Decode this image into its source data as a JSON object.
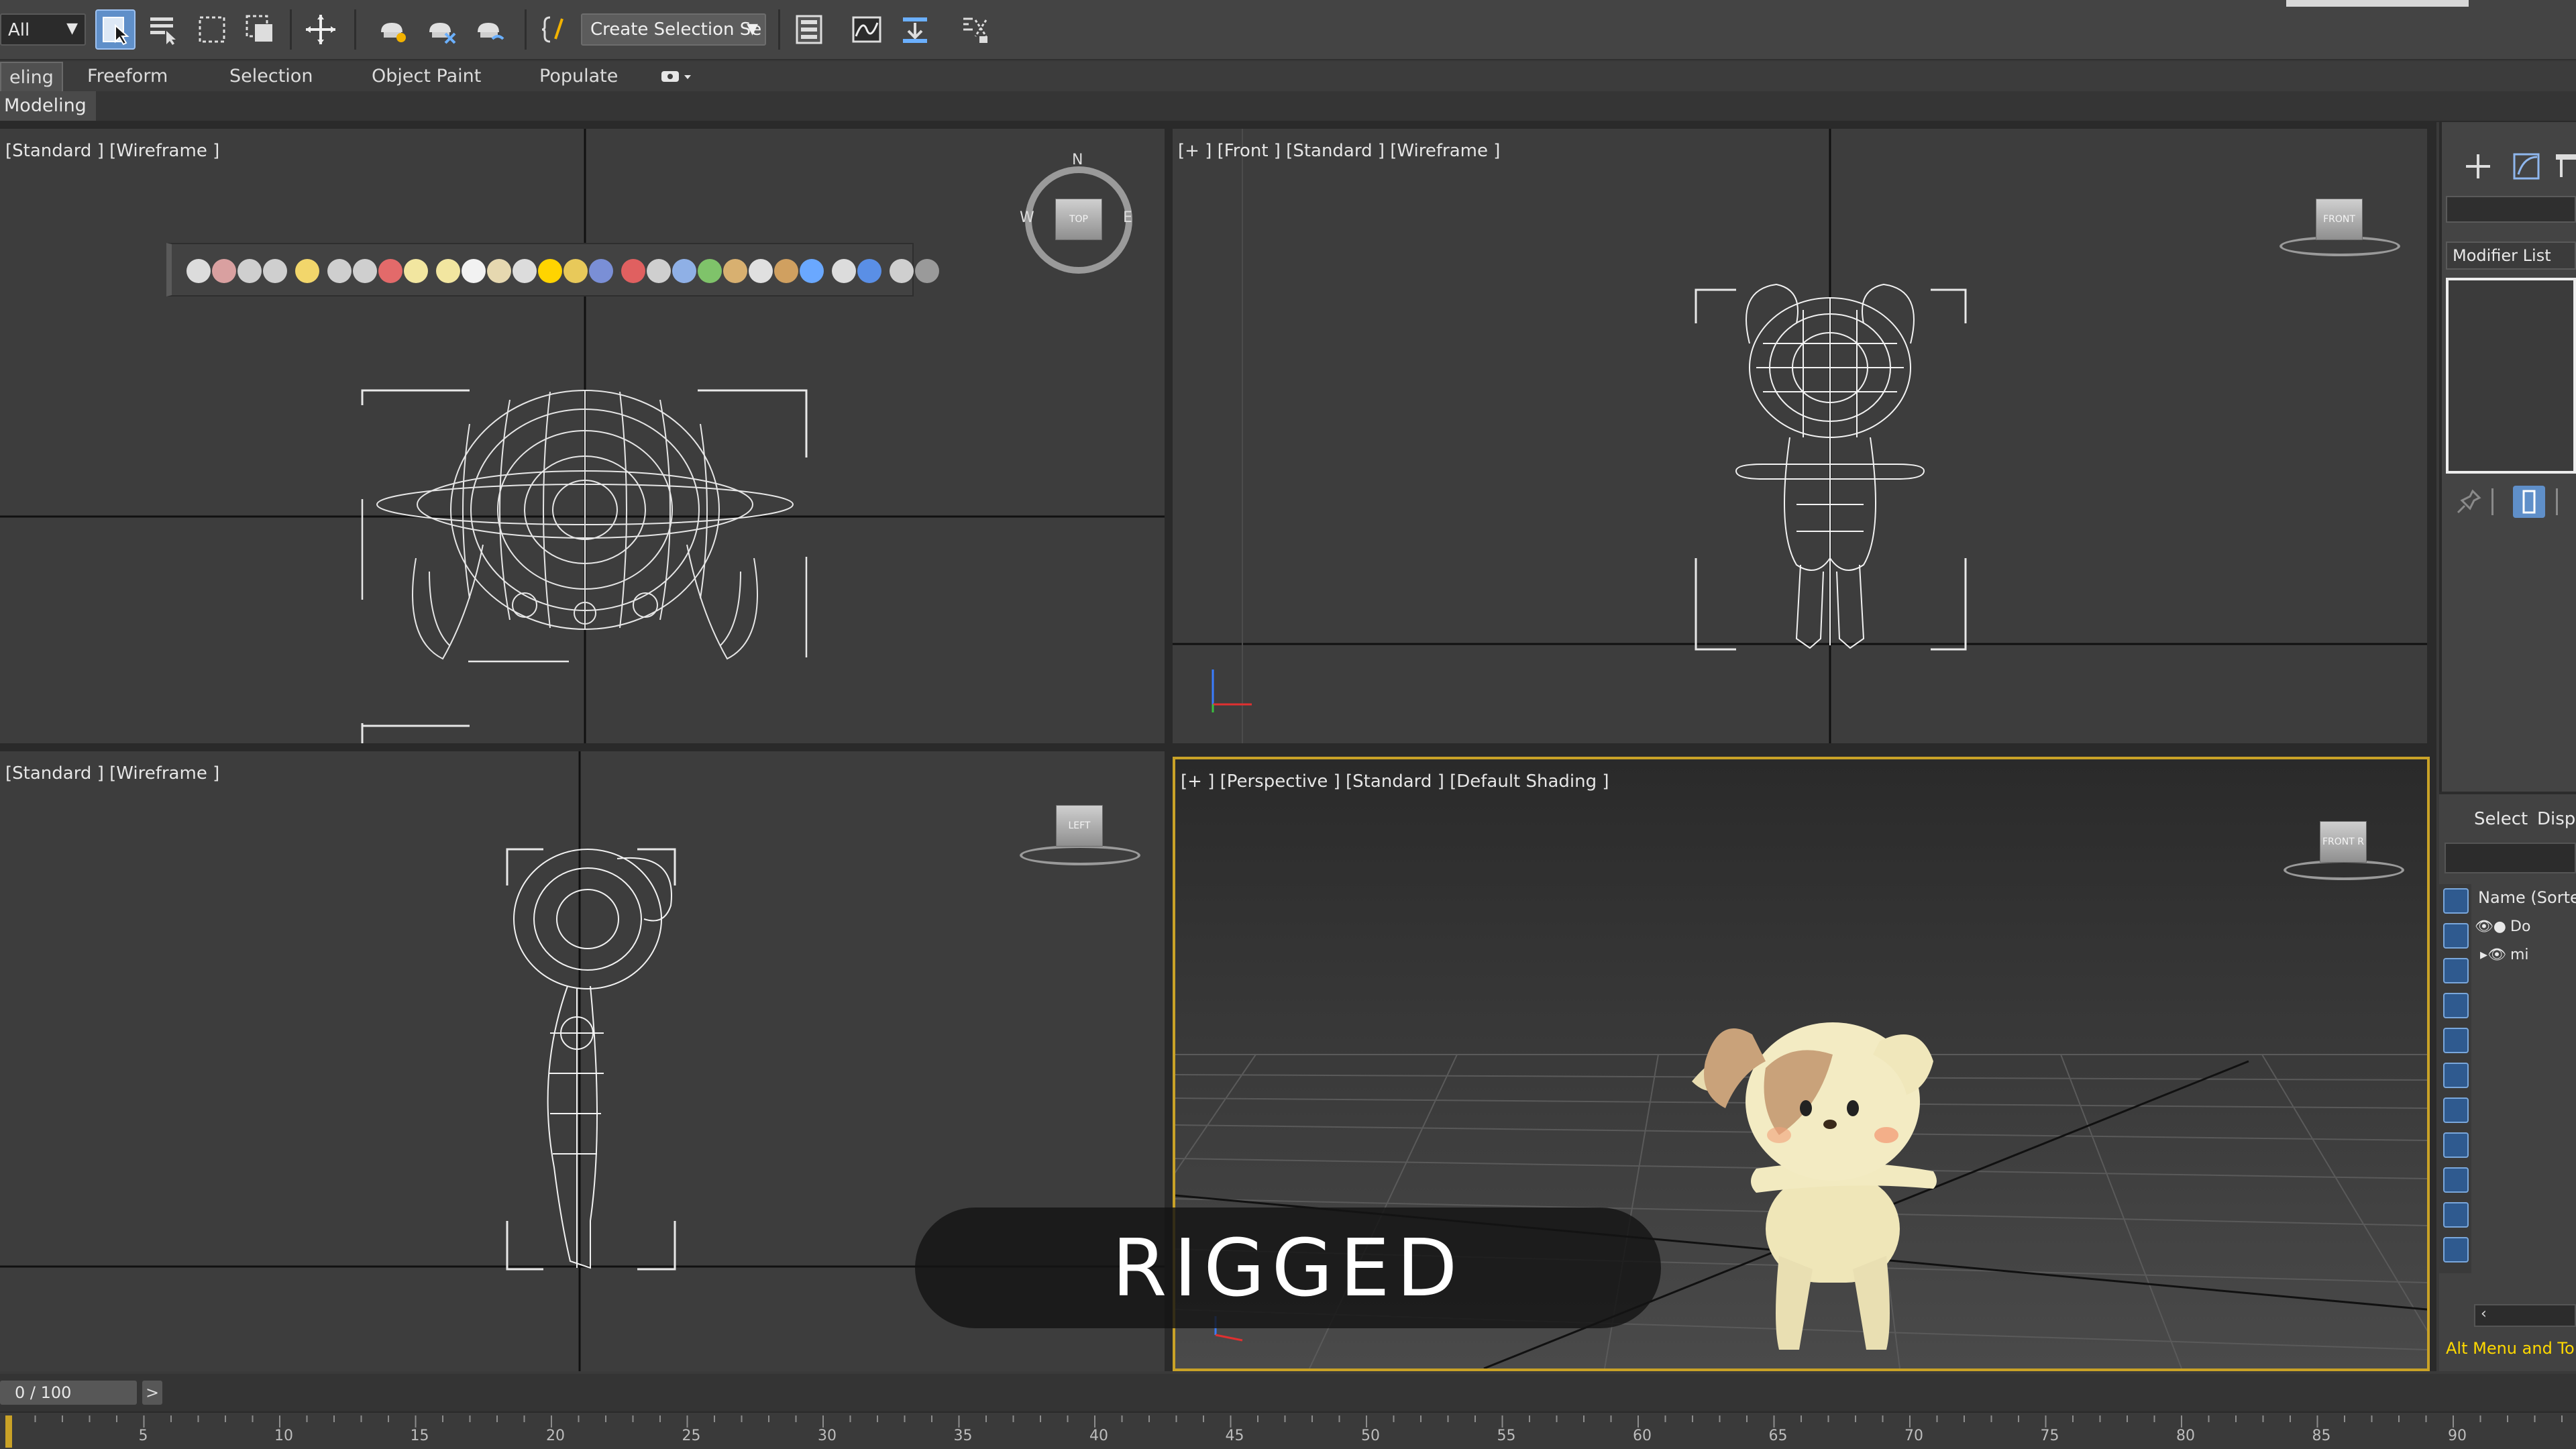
{
  "toolbar": {
    "selection_filter": "All",
    "named_selection": "Create Selection Se",
    "icons": [
      "select-object-icon",
      "select-by-name-icon",
      "rectangular-region-icon",
      "window-crossing-icon",
      "select-move-icon",
      "link-icon",
      "unlink-icon",
      "bind-space-warp-icon",
      "edit-named-selection-icon",
      "layer-explorer-icon",
      "curve-editor-icon",
      "schematic-view-icon",
      "material-editor-icon"
    ]
  },
  "ribbon": {
    "tabs": [
      {
        "label": "eling",
        "active": true
      },
      {
        "label": "Freeform"
      },
      {
        "label": "Selection"
      },
      {
        "label": "Object Paint"
      },
      {
        "label": "Populate"
      }
    ],
    "panel_label": "Modeling"
  },
  "viewports": {
    "top": {
      "label": "[Standard ] [Wireframe ]",
      "compass": {
        "n": "N",
        "w": "W",
        "e": "E",
        "cube": "TOP"
      }
    },
    "front": {
      "label": "[+ ] [Front ] [Standard ] [Wireframe ]",
      "cube": "FRONT"
    },
    "left": {
      "label": "[Standard ] [Wireframe ]",
      "cube": "LEFT"
    },
    "perspective": {
      "label": "[+ ] [Perspective ] [Standard ] [Default Shading ]",
      "cube": "FRONT R"
    }
  },
  "overlay": {
    "text": "RIGGED"
  },
  "command_panel": {
    "modifier_list": "Modifier List"
  },
  "scene_explorer": {
    "tabs": [
      "Select",
      "Displ"
    ],
    "header": "Name (Sorted",
    "rows": [
      {
        "label": "Do"
      },
      {
        "label": "mi"
      }
    ]
  },
  "prompt": {
    "text": "Alt Menu and To"
  },
  "timeline": {
    "frame_counter": "0 / 100",
    "next_label": ">",
    "ticks": [
      "5",
      "10",
      "15",
      "20",
      "25",
      "30",
      "35",
      "40",
      "45",
      "50",
      "55",
      "60",
      "65",
      "70",
      "75",
      "80",
      "85",
      "90"
    ]
  },
  "colors": {
    "active_viewport_border": "#c9a227",
    "prompt": "#ffd900",
    "active_button": "#5f8fc9"
  }
}
